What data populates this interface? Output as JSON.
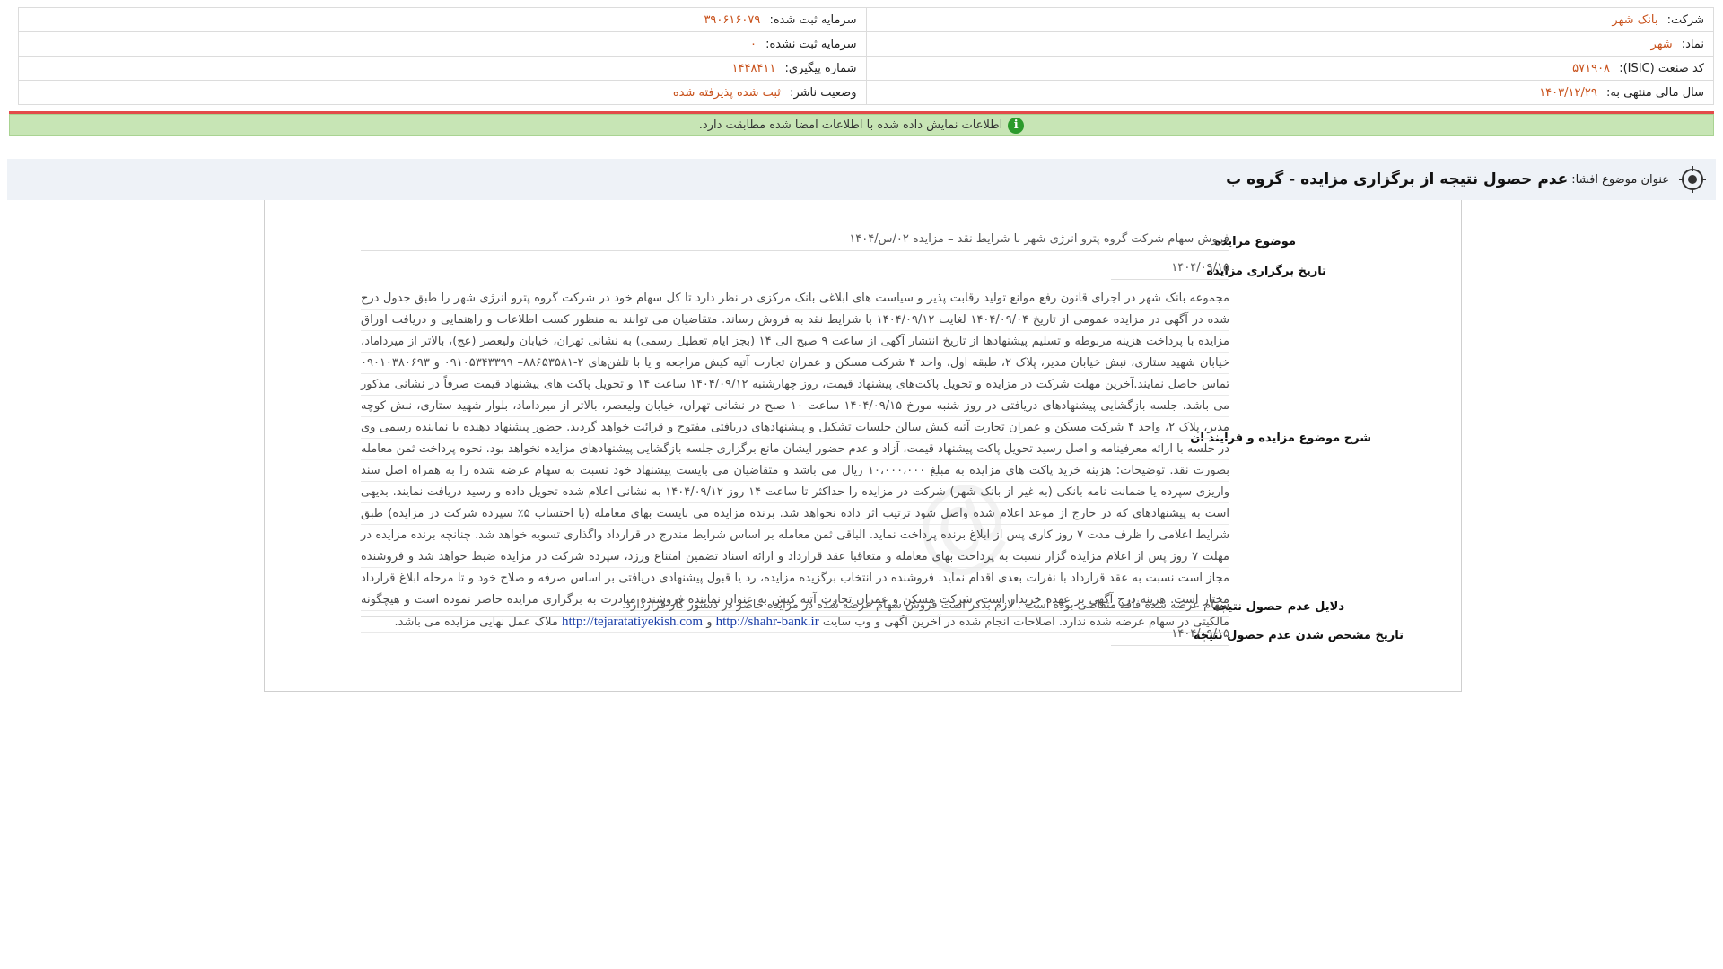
{
  "company": {
    "label": "شرکت:",
    "value": "بانک شهر"
  },
  "symbol": {
    "label": "نماد:",
    "value": "شهر"
  },
  "isic": {
    "label": "کد صنعت (ISIC):",
    "value": "۵۷۱۹۰۸"
  },
  "fiscal_year": {
    "label": "سال مالی منتهی به:",
    "value": "۱۴۰۳/۱۲/۲۹"
  },
  "registered_capital": {
    "label": "سرمایه ثبت شده:",
    "value": "۳۹۰۶۱۶۰۷۹"
  },
  "unregistered_capital": {
    "label": "سرمایه ثبت نشده:",
    "value": "۰"
  },
  "tracking_number": {
    "label": "شماره پیگیری:",
    "value": "۱۴۴۸۴۱۱"
  },
  "publisher_status": {
    "label": "وضعیت ناشر:",
    "value": "ثبت شده پذیرفته شده"
  },
  "notice": {
    "text": "اطلاعات نمایش داده شده با اطلاعات امضا شده مطابقت دارد."
  },
  "disclosure": {
    "title_prefix": "عنوان موضوع افشا:",
    "title": "عدم حصول نتیجه از برگزاری مزایده - گروه ب"
  },
  "auction": {
    "subject_label": "موضوع مزایده",
    "subject_value": "فروش سهام شرکت گروه پترو انرژی شهر با شرایط نقد – مزایده ۰۲/س/۱۴۰۴",
    "date_label": "تاریخ برگزاری مزایده",
    "date_value": "۱۴۰۴/۰۹/۱۵",
    "process_label": "شرح موضوع مزایده و فرایند ان",
    "process_text": "مجموعه بانک شهر در اجرای قانون رفع موانع تولید رقابت پذیر و سیاست های ابلاغی بانک مرکزی در نظر دارد تا کل سهام خود در شرکت گروه پترو انرژی شهر را طبق جدول درج شده در آگهی در مزایده عمومی از تاریخ ۱۴۰۴/۰۹/۰۴ لغایت ۱۴۰۴/۰۹/۱۲ با شرایط نقد به فروش رساند. متقاضیان می توانند به منظور کسب اطلاعات و راهنمایی و دریافت اوراق مزایده با پرداخت هزینه مربوطه و تسلیم پیشنهادها از تاریخ انتشار آگهی از ساعت ۹ صبح الی ۱۴ (بجز ایام تعطیل رسمی) به نشانی تهران، خیابان ولیعصر (عج)، بالاتر از میرداماد، خیابان شهید ستاری، نبش خیابان مدیر، پلاک ۲، طبقه اول، واحد ۴ شرکت مسکن و عمران تجارت آتیه کیش مراجعه و یا با تلفن‌های ۲-۸۸۶۵۳۵۸۱– ۰۹۱۰۵۳۴۳۳۹۹ و ۰۹۰۱۰۳۸۰۶۹۳ تماس حاصل نمایند.آخرین مهلت شرکت در مزایده و تحویل پاکت‌های پیشنهاد قیمت، روز چهارشنبه ۱۴۰۴/۰۹/۱۲ ساعت ۱۴ و تحویل پاکت های پیشنهاد قیمت صرفاً در نشانی مذکور می باشد. جلسه بازگشایی پیشنهادهای دریافتی در روز شنبه مورخ ۱۴۰۴/۰۹/۱۵ ساعت ۱۰ صبح در نشانی تهران، خیابان ولیعصر، بالاتر از میرداماد، بلوار شهید ستاری، نبش کوچه مدیر، پلاک ۲، واحد ۴ شرکت مسکن و عمران تجارت آتیه کیش سالن جلسات تشکیل و پیشنهادهای دریافتی مفتوح و قرائت خواهد گردید. حضور پیشنهاد دهنده یا نماینده رسمی وی در جلسه با ارائه معرفینامه و اصل رسید تحویل پاکت پیشنهاد قیمت، آزاد و عدم حضور ایشان مانع برگزاری جلسه بازگشایی پیشنهادهای مزایده نخواهد بود. نحوه پرداخت ثمن معامله بصورت نقد. توضیحات: هزینه خرید پاکت های مزایده به مبلغ ۱۰،۰۰۰،۰۰۰ ریال می باشد و متقاضیان می بایست پیشنهاد خود نسبت به سهام عرضه شده را به همراه اصل سند واریزی سپرده یا ضمانت نامه بانکی (به غیر از بانک شهر) شرکت در مزایده را حداکثر تا ساعت ۱۴ روز ۱۴۰۴/۰۹/۱۲ به نشانی اعلام شده تحویل داده و رسید دریافت نمایند. بدیهی است به پیشنهادهای که در خارج از موعد اعلام شده واصل شود ترتیب اثر داده نخواهد شد. برنده مزایده می بایست بهای معامله (با احتساب ۵٪ سپرده شرکت در مزایده) طبق شرایط اعلامی را ظرف مدت ۷ روز کاری پس از ابلاغ برنده پرداخت نماید. الباقی ثمن معامله بر اساس شرایط مندرج در قرارداد واگذاری تسویه خواهد شد. چنانچه برنده مزایده در مهلت ۷ روز پس از اعلام مزایده گزار نسبت به پرداخت بهای معامله و متعاقبا عقد قرارداد و ارائه اسناد تضمین امتناع ورزد، سپرده شرکت در مزایده ضبط خواهد شد و فروشنده مجاز است نسبت به عقد قرارداد با نفرات بعدی اقدام نماید. فروشنده در انتخاب برگزیده مزایده، رد یا قبول پیشنهادی دریافتی بر اساس صرفه و صلاح خود و تا مرحله ابلاغ قرارداد مختار است. هزینه درج آگهی بر عهده خریدار است. شرکت مسکن و عمران تجارت آتیه کیش به عنوان نماینده فروشنده مبادرت به برگزاری مزایده حاضر نموده است و هیچگونه مالکیتی در سهام عرضه شده ندارد. اصلاحات انجام شده در آخرین آگهی و وب سایت",
    "link1": "http://shahr-bank.ir",
    "link_joiner": "و",
    "link2": "http://tejaratatiyekish.com",
    "process_tail": "ملاک عمل نهایی مزایده می باشد.",
    "reasons_label": "دلایل عدم حصول نتیجه",
    "reasons_value": "سهام عرضه شده فاقد متقاضی بوده است . لازم بذکر است فروش سهام عرضه شده در مزایده حاضر در دستور کار قراردارد.",
    "result_date_label": "تاریخ مشخص شدن عدم حصول نتیجه",
    "result_date_value": "۱۴۰۴/۰۹/۱۵"
  },
  "watermark": "@"
}
